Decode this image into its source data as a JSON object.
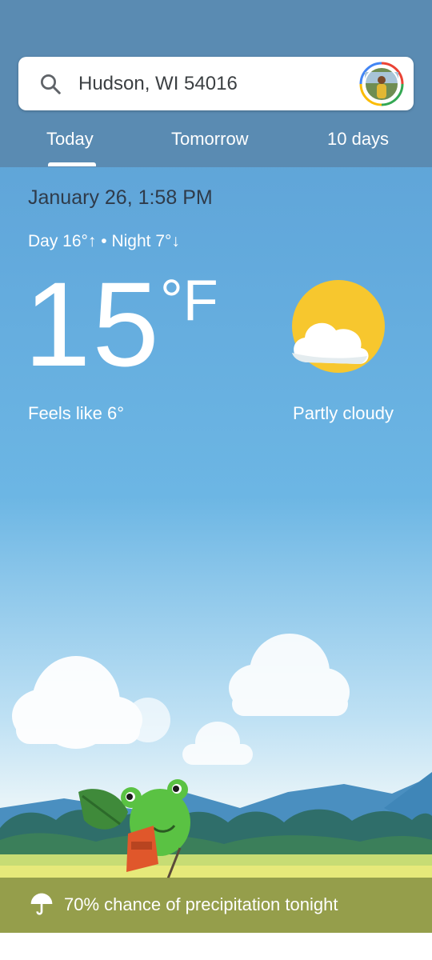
{
  "search": {
    "location": "Hudson, WI 54016"
  },
  "tabs": [
    {
      "label": "Today",
      "selected": true
    },
    {
      "label": "Tomorrow",
      "selected": false
    },
    {
      "label": "10 days",
      "selected": false
    }
  ],
  "weather": {
    "datetime": "January 26, 1:58 PM",
    "day_night": "Day 16°↑ • Night 7°↓",
    "temperature": "15",
    "unit": "°F",
    "feels_like": "Feels like 6°",
    "condition": "Partly cloudy",
    "condition_icon": "partly-cloudy-icon"
  },
  "precipitation": {
    "text": "70% chance of precipitation tonight",
    "icon": "umbrella-icon"
  },
  "colors": {
    "appbar": "#5a8bb2",
    "sun": "#f7c72e",
    "precip_bar": "#8c9646"
  }
}
